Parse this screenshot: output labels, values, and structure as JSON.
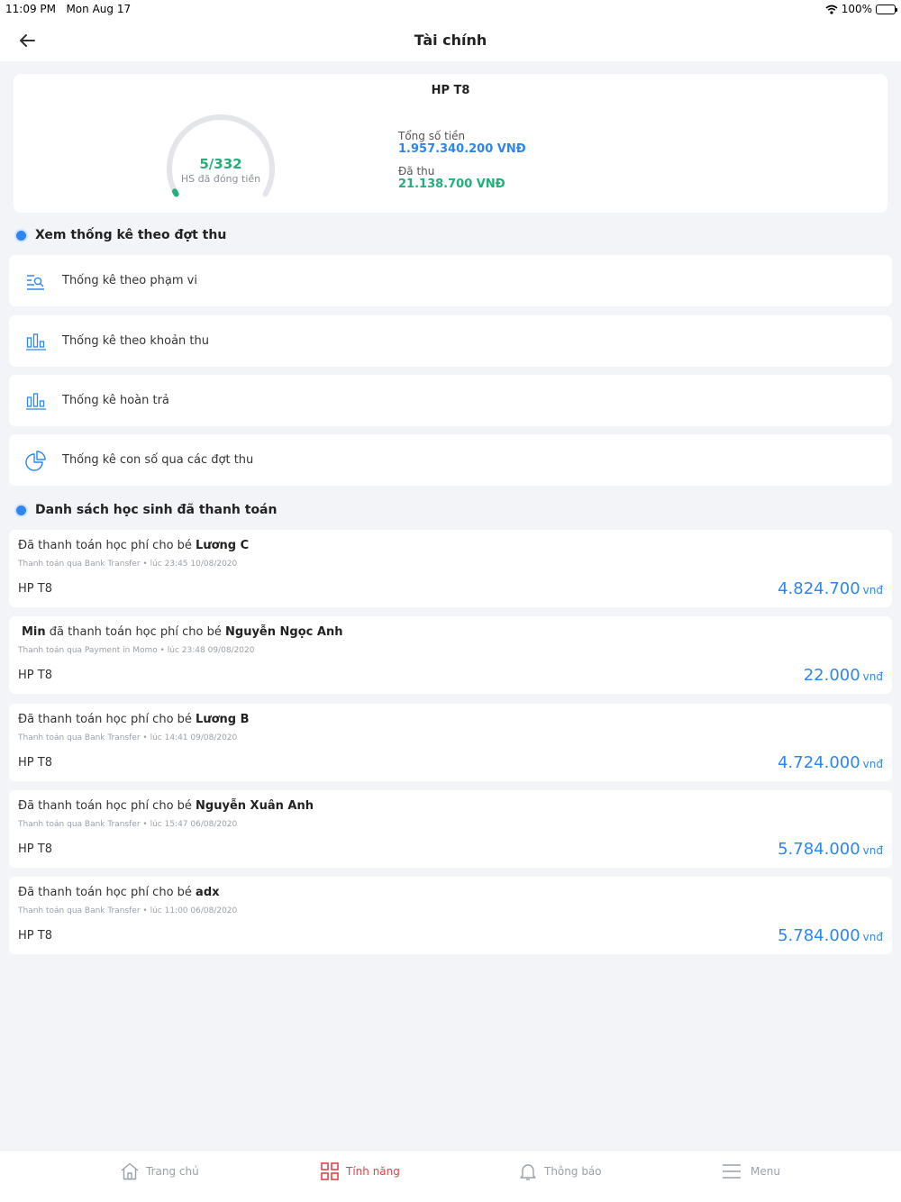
{
  "status": {
    "time": "11:09 PM",
    "date": "Mon Aug 17",
    "battery": "100%"
  },
  "nav": {
    "title": "Tài chính"
  },
  "summary": {
    "title": "HP T8",
    "paid_count": "5/332",
    "paid_fraction": 0.015,
    "paid_count_label": "HS đã đóng tiền",
    "total_label": "Tổng số tiền",
    "total_value": "1.957.340.200 VNĐ",
    "collected_label": "Đã thu",
    "collected_value": "21.138.700 VNĐ"
  },
  "stats_section": {
    "title": "Xem thống kê theo đợt thu",
    "items": [
      {
        "label": "Thống kê theo phạm vi",
        "icon": "search-list-icon"
      },
      {
        "label": "Thống kê theo khoản thu",
        "icon": "bar-chart-icon"
      },
      {
        "label": "Thống kê hoàn trả",
        "icon": "bar-chart-icon"
      },
      {
        "label": "Thống kê con số qua các đợt thu",
        "icon": "pie-chart-icon"
      }
    ]
  },
  "payments_section": {
    "title": "Danh sách học sinh đã thanh toán",
    "items": [
      {
        "payer": "",
        "text": "Đã thanh toán học phí cho bé ",
        "student": "Lương C",
        "detail": "Thanh toán qua Bank Transfer • lúc 23:45 10/08/2020",
        "period": "HP T8",
        "amount": "4.824.700",
        "currency": "vnđ"
      },
      {
        "payer": "Min",
        "text": " đã thanh toán học phí cho bé ",
        "student": "Nguyễn Ngọc Anh",
        "detail": "Thanh toán qua Payment in Momo • lúc 23:48 09/08/2020",
        "period": "HP T8",
        "amount": "22.000",
        "currency": "vnđ"
      },
      {
        "payer": "",
        "text": "Đã thanh toán học phí cho bé ",
        "student": "Lương B",
        "detail": "Thanh toán qua Bank Transfer • lúc 14:41 09/08/2020",
        "period": "HP T8",
        "amount": "4.724.000",
        "currency": "vnđ"
      },
      {
        "payer": "",
        "text": "Đã thanh toán học phí cho bé ",
        "student": "Nguyễn Xuân Anh",
        "detail": "Thanh toán qua Bank Transfer • lúc 15:47 06/08/2020",
        "period": "HP T8",
        "amount": "5.784.000",
        "currency": "vnđ"
      },
      {
        "payer": "",
        "text": "Đã thanh toán học phí cho bé ",
        "student": " adx",
        "detail": "Thanh toán qua Bank Transfer • lúc 11:00 06/08/2020",
        "period": "HP T8",
        "amount": "5.784.000",
        "currency": "vnđ"
      }
    ]
  },
  "tabs": [
    {
      "label": "Trang chủ",
      "icon": "home-icon",
      "active": false
    },
    {
      "label": "Tính năng",
      "icon": "grid-icon",
      "active": true
    },
    {
      "label": "Thông báo",
      "icon": "bell-icon",
      "active": false
    },
    {
      "label": "Menu",
      "icon": "menu-icon",
      "active": false
    }
  ],
  "colors": {
    "accent": "#2d86f0",
    "success": "#21b07a",
    "active_tab": "#e2434b"
  }
}
